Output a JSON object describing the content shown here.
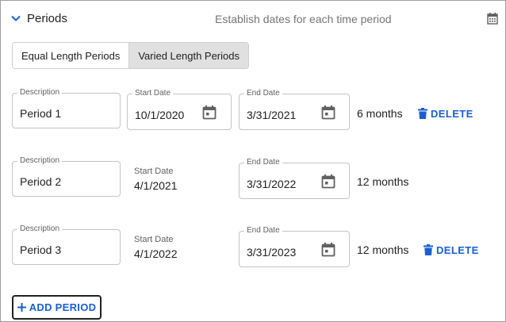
{
  "header": {
    "title": "Periods",
    "subtitle": "Establish dates for each time period"
  },
  "toggle": {
    "options": [
      "Equal Length Periods",
      "Varied Length Periods"
    ],
    "selected": "Varied Length Periods"
  },
  "periods": [
    {
      "description_label": "Description",
      "description": "Period 1",
      "start_label": "Start Date",
      "start": "10/1/2020",
      "start_editable": true,
      "end_label": "End Date",
      "end": "3/31/2021",
      "duration": "6 months",
      "delete_label": "DELETE"
    },
    {
      "description_label": "Description",
      "description": "Period 2",
      "start_label": "Start Date",
      "start": "4/1/2021",
      "start_editable": false,
      "end_label": "End Date",
      "end": "3/31/2022",
      "duration": "12 months"
    },
    {
      "description_label": "Description",
      "description": "Period 3",
      "start_label": "Start Date",
      "start": "4/1/2022",
      "start_editable": false,
      "end_label": "End Date",
      "end": "3/31/2023",
      "duration": "12 months",
      "delete_label": "DELETE"
    }
  ],
  "add_button_label": "ADD PERIOD",
  "colors": {
    "accent": "#1a5fd0",
    "toggle_selected_bg": "#e0e0e0",
    "border": "#c4c4c4",
    "muted_text": "#757575"
  },
  "icons": {
    "expand": "chevron-down-icon",
    "header": "calendar-icon",
    "date_picker": "calendar-icon",
    "delete": "trash-icon",
    "add": "plus-icon"
  }
}
